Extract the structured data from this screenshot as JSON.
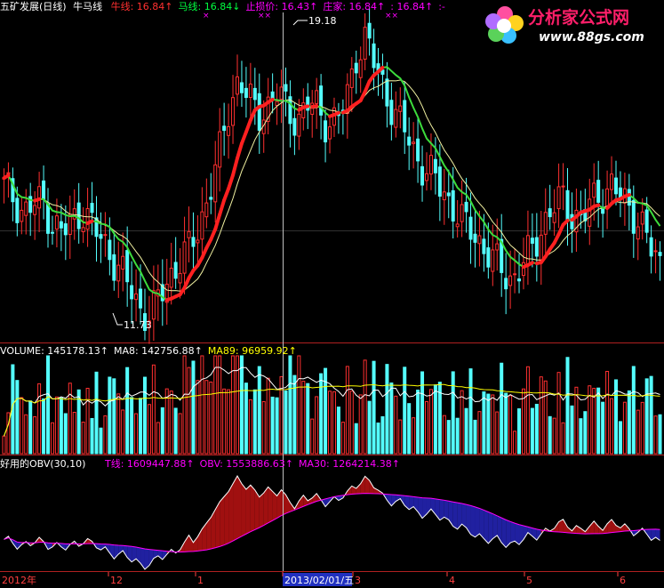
{
  "price_panel": {
    "title": "五矿发展(日线)",
    "indicator_name": "牛马线",
    "indicators": [
      {
        "label": "牛线: 16.84↑",
        "color": "#ff3030"
      },
      {
        "label": "马线: 16.84↓",
        "color": "#00ff40"
      },
      {
        "label": "止损价: 16.43↑",
        "color": "#ff00ff"
      },
      {
        "label": "庄家: 16.84↑",
        "color": "#ff00ff"
      },
      {
        "label": ": 16.84↑",
        "color": "#ff00ff"
      },
      {
        "label": ":-",
        "color": "#ff00ff"
      }
    ],
    "marks": [
      "××",
      "×",
      "××"
    ]
  },
  "volume_panel": {
    "indicators": [
      {
        "label": "VOLUME: 145178.13↑",
        "color": "#ffffff"
      },
      {
        "label": "MA8: 142756.88↑",
        "color": "#ffffff"
      },
      {
        "label": "MA89: 96959.92↑",
        "color": "#ffff00"
      }
    ]
  },
  "obv_panel": {
    "title": "好用的OBV(30,10)",
    "indicators": [
      {
        "label": "T线: 1609447.88↑",
        "color": "#ff00ff"
      },
      {
        "label": "OBV: 1553886.63↑",
        "color": "#ff00ff"
      },
      {
        "label": "MA30: 1264214.38↑",
        "color": "#ff00ff"
      }
    ]
  },
  "time_axis": {
    "labels": [
      "2012年",
      "12",
      "1",
      "2013/02/01/五",
      "3",
      "4",
      "5",
      "6"
    ],
    "cursor_label": "2013/02/01/五"
  },
  "logo": {
    "text_main": "分析家公式网",
    "text_url": "www.88gs.com"
  },
  "colors": {
    "up": "#ff3030",
    "down": "#54ffff",
    "niu_line": "#ff2020",
    "ma_line": "#3cdc3c",
    "volume_ma8": "#ffffff",
    "volume_ma89": "#ffff00",
    "obv_fill_up": "#a01010",
    "obv_fill_down": "#2020a0"
  },
  "chart_data": {
    "type": "candlestick",
    "price": {
      "high_label": "19.18",
      "low_label": "11.73",
      "high_value": 19.18,
      "low_value": 11.73,
      "ylim": [
        11.3,
        19.6
      ]
    },
    "seed_closes": [
      15.2,
      14.9,
      14.5,
      14.7,
      14.8,
      14.2,
      14.0,
      14.3,
      14.6,
      14.2,
      13.8,
      13.4,
      13.0,
      12.5,
      12.0,
      11.9,
      12.4,
      12.9,
      13.3,
      13.6,
      14.2,
      15.1,
      16.0,
      17.2,
      18.0,
      17.4,
      17.0,
      17.3,
      17.6,
      17.1,
      16.9,
      17.3,
      17.2,
      16.8,
      16.9,
      17.4,
      18.6,
      19.0,
      18.2,
      17.6,
      17.0,
      16.6,
      16.0,
      15.6,
      15.4,
      15.0,
      14.6,
      14.2,
      14.0,
      13.6,
      13.3,
      13.0,
      12.8,
      13.2,
      13.6,
      14.2,
      14.6,
      14.9,
      14.5,
      14.3,
      14.8,
      15.0,
      15.2,
      14.9,
      14.6,
      14.3,
      13.6,
      13.2
    ]
  }
}
